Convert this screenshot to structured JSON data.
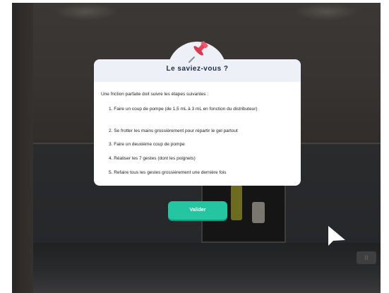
{
  "dialog": {
    "title": "Le saviez-vous ?",
    "intro": "Une friction parfaite doit suivre les étapes suivantes :",
    "steps": [
      "1. Faire un coup de pompe (de 1,5 mL à 3 mL en fonction du distributeur)",
      "2. Se frotter les mains grossièrement pour répartir le gel partout",
      "3. Faire un deuxième coup de pompe",
      "4. Réaliser les 7 gestes (dont les poignets)",
      "5. Refaire tous les gestes grossièrement une dernière fois"
    ],
    "icon": "push-pin-icon"
  },
  "buttons": {
    "valider_label": "Valider"
  },
  "scene": {
    "switch_label": "II",
    "cursor_icon": "arrow-cursor-icon"
  },
  "colors": {
    "accent": "#24c6a1",
    "header_bg": "#eef0f8",
    "title": "#1f2a44",
    "pin": "#e8435a"
  }
}
